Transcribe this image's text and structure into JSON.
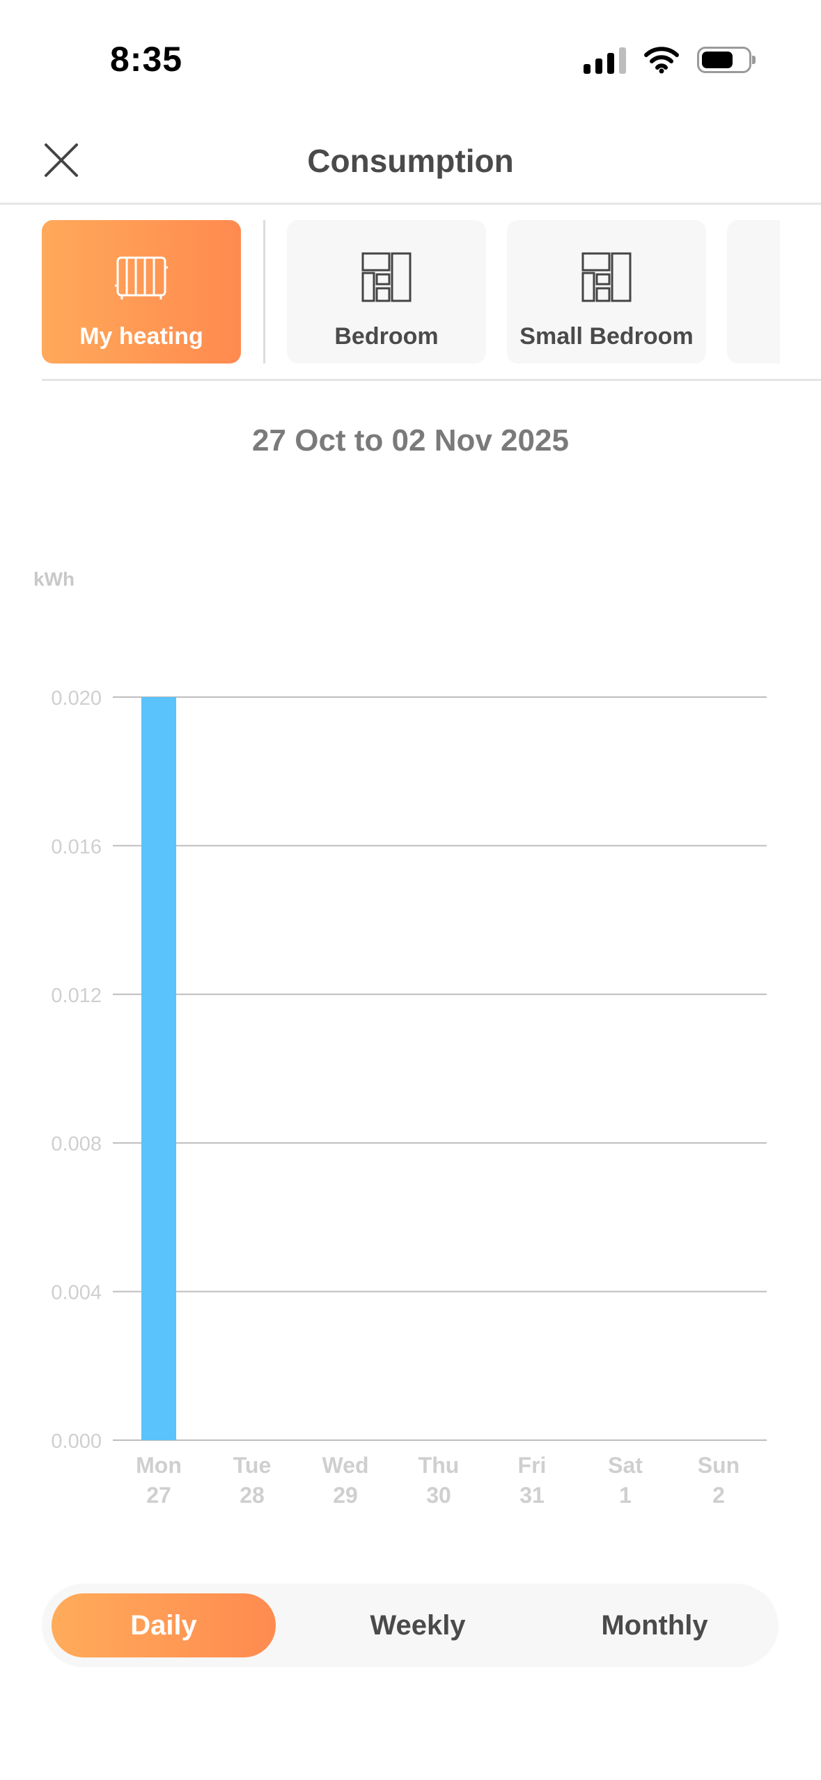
{
  "status_bar": {
    "time": "8:35"
  },
  "header": {
    "title": "Consumption"
  },
  "devices": [
    {
      "label": "My heating",
      "icon": "radiator-icon",
      "active": true
    },
    {
      "label": "Bedroom",
      "icon": "room-layout-icon",
      "active": false
    },
    {
      "label": "Small Bedroom",
      "icon": "room-layout-icon",
      "active": false
    }
  ],
  "date_range": "27 Oct to 02 Nov 2025",
  "colors": {
    "accent_start": "#ffa95a",
    "accent_end": "#ff8a4f",
    "bar": "#5ac3fb"
  },
  "chart_data": {
    "type": "bar",
    "ylabel": "kWh",
    "ylim": [
      0,
      0.02
    ],
    "yticks": [
      "0.000",
      "0.004",
      "0.008",
      "0.012",
      "0.016",
      "0.020"
    ],
    "categories": [
      {
        "day": "Mon",
        "date": "27"
      },
      {
        "day": "Tue",
        "date": "28"
      },
      {
        "day": "Wed",
        "date": "29"
      },
      {
        "day": "Thu",
        "date": "30"
      },
      {
        "day": "Fri",
        "date": "31"
      },
      {
        "day": "Sat",
        "date": "1"
      },
      {
        "day": "Sun",
        "date": "2"
      }
    ],
    "values": [
      0.02,
      0,
      0,
      0,
      0,
      0,
      0
    ],
    "grid": true
  },
  "period_toggle": {
    "options": [
      "Daily",
      "Weekly",
      "Monthly"
    ],
    "selected": "Daily"
  }
}
